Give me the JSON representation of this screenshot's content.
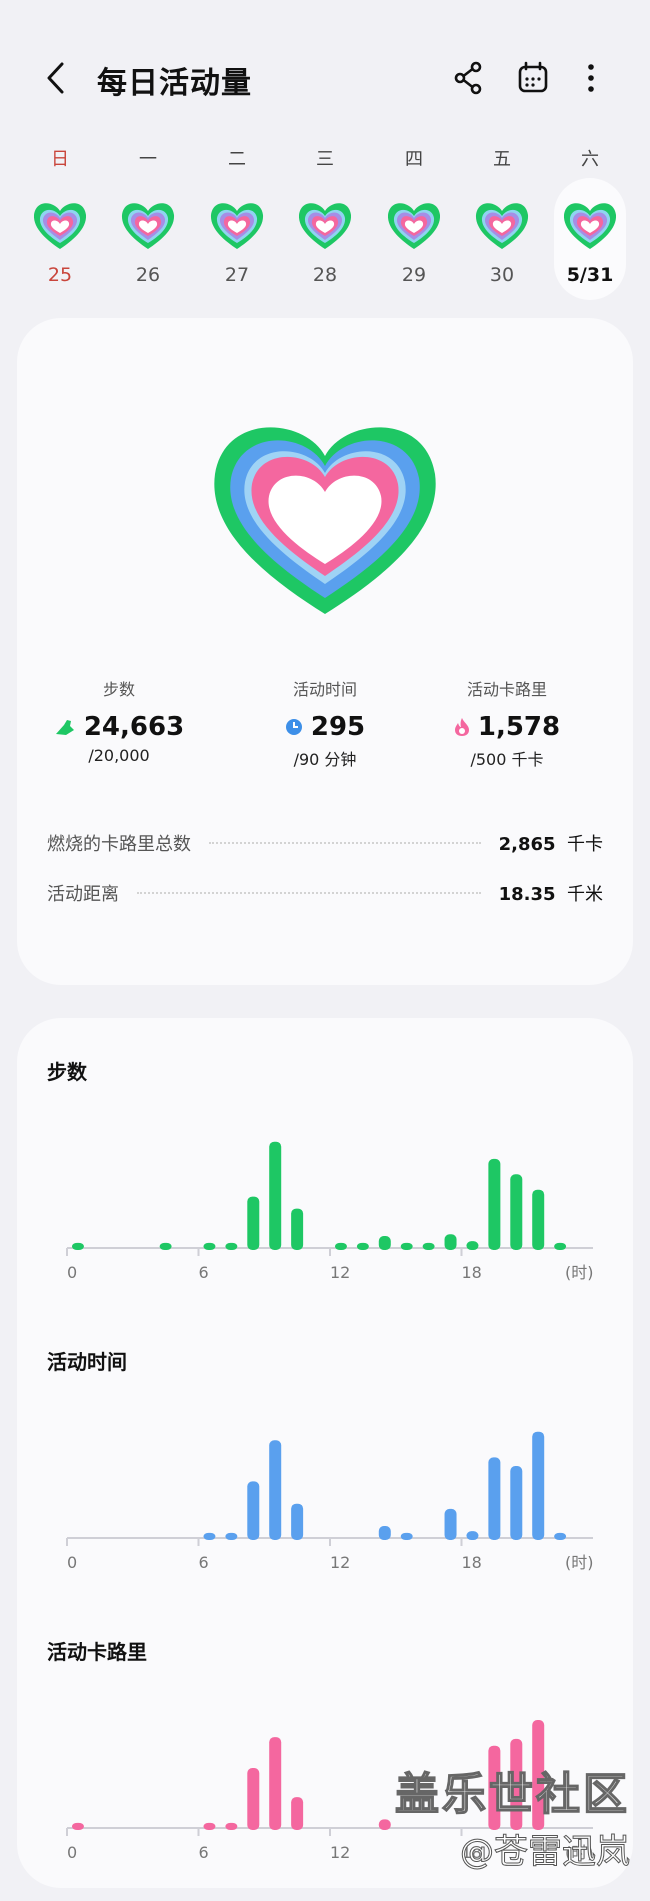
{
  "header": {
    "title": "每日活动量",
    "icons": [
      "back-icon",
      "share-icon",
      "calendar-icon",
      "more-icon"
    ]
  },
  "week": {
    "days": [
      {
        "label": "日",
        "date": "25",
        "sunday": true
      },
      {
        "label": "一",
        "date": "26"
      },
      {
        "label": "二",
        "date": "27"
      },
      {
        "label": "三",
        "date": "28"
      },
      {
        "label": "四",
        "date": "29"
      },
      {
        "label": "五",
        "date": "30"
      },
      {
        "label": "六",
        "date": "5/31",
        "selected": true
      }
    ]
  },
  "summary": {
    "steps": {
      "label": "步数",
      "value": "24,663",
      "goal": "/20,000"
    },
    "active_time": {
      "label": "活动时间",
      "value": "295",
      "goal": "/90 分钟"
    },
    "active_calories": {
      "label": "活动卡路里",
      "value": "1,578",
      "goal": "/500 千卡"
    },
    "total_burned": {
      "label": "燃烧的卡路里总数",
      "value": "2,865",
      "unit": "千卡"
    },
    "distance": {
      "label": "活动距离",
      "value": "18.35",
      "unit": "千米"
    }
  },
  "colors": {
    "green": "#1ec764",
    "blue": "#5aa0ee",
    "pink": "#f4679f",
    "sunday_red": "#c9453b"
  },
  "x_ticks": [
    "0",
    "6",
    "12",
    "18"
  ],
  "x_unit": "(时)",
  "chart_data": [
    {
      "type": "bar",
      "title": "步数",
      "categories": [
        "0",
        "1",
        "2",
        "3",
        "4",
        "5",
        "6",
        "7",
        "8",
        "9",
        "10",
        "11",
        "12",
        "13",
        "14",
        "15",
        "16",
        "17",
        "18",
        "19",
        "20",
        "21",
        "22",
        "23"
      ],
      "values": [
        3,
        0,
        0,
        0,
        3,
        0,
        3,
        3,
        30,
        62,
        23,
        0,
        3,
        3,
        7,
        3,
        3,
        8,
        4,
        52,
        43,
        34,
        3,
        0
      ],
      "ylim": [
        0,
        70
      ],
      "color": "#1ec764"
    },
    {
      "type": "bar",
      "title": "活动时间",
      "categories": [
        "0",
        "1",
        "2",
        "3",
        "4",
        "5",
        "6",
        "7",
        "8",
        "9",
        "10",
        "11",
        "12",
        "13",
        "14",
        "15",
        "16",
        "17",
        "18",
        "19",
        "20",
        "21",
        "22",
        "23"
      ],
      "values": [
        0,
        0,
        0,
        0,
        0,
        0,
        3,
        3,
        33,
        57,
        20,
        0,
        0,
        0,
        7,
        3,
        0,
        17,
        4,
        47,
        42,
        62,
        3,
        0
      ],
      "ylim": [
        0,
        70
      ],
      "color": "#5aa0ee"
    },
    {
      "type": "bar",
      "title": "活动卡路里",
      "categories": [
        "0",
        "1",
        "2",
        "3",
        "4",
        "5",
        "6",
        "7",
        "8",
        "9",
        "10",
        "11",
        "12",
        "13",
        "14",
        "15",
        "16",
        "17",
        "18",
        "19",
        "20",
        "21",
        "22",
        "23"
      ],
      "values": [
        3,
        0,
        0,
        0,
        0,
        0,
        3,
        3,
        35,
        53,
        18,
        0,
        0,
        0,
        5,
        0,
        0,
        0,
        0,
        48,
        52,
        63,
        0,
        0
      ],
      "ylim": [
        0,
        70
      ],
      "color": "#f4679f"
    }
  ],
  "watermark": {
    "line1": "盖乐世社区",
    "line2": "@苍雷迅岚"
  }
}
